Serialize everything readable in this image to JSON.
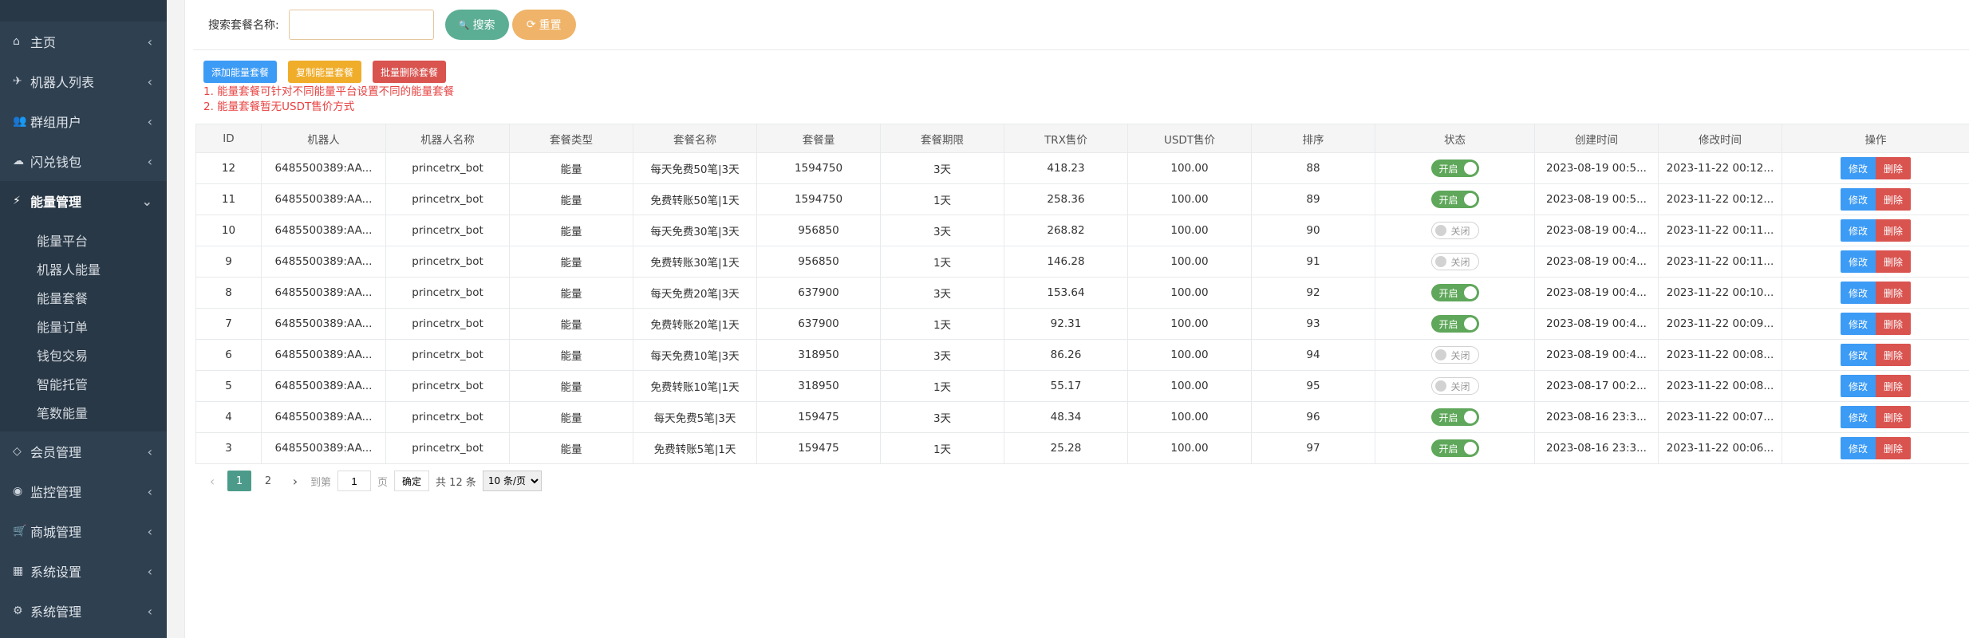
{
  "sidebar": {
    "items": [
      {
        "label": "主页",
        "icon": "home-icon",
        "glyph": "⌂",
        "arrow": "‹"
      },
      {
        "label": "机器人列表",
        "icon": "plane-icon",
        "glyph": "✈",
        "arrow": "‹"
      },
      {
        "label": "群组用户",
        "icon": "users-icon",
        "glyph": "👥",
        "arrow": "‹"
      },
      {
        "label": "闪兑钱包",
        "icon": "cloud-icon",
        "glyph": "☁",
        "arrow": "‹"
      },
      {
        "label": "能量管理",
        "icon": "bolt-icon",
        "glyph": "⚡",
        "arrow": "⌄"
      }
    ],
    "submenu": [
      "能量平台",
      "机器人能量",
      "能量套餐",
      "能量订单",
      "钱包交易",
      "智能托管",
      "笔数能量"
    ],
    "items_after": [
      {
        "label": "会员管理",
        "icon": "diamond-icon",
        "glyph": "◇",
        "arrow": "‹"
      },
      {
        "label": "监控管理",
        "icon": "monitor-icon",
        "glyph": "◉",
        "arrow": "‹"
      },
      {
        "label": "商城管理",
        "icon": "cart-icon",
        "glyph": "🛒",
        "arrow": "‹"
      },
      {
        "label": "系统设置",
        "icon": "windows-icon",
        "glyph": "▦",
        "arrow": "‹"
      },
      {
        "label": "系统管理",
        "icon": "gear-icon",
        "glyph": "⚙",
        "arrow": "‹"
      }
    ]
  },
  "search": {
    "label": "搜索套餐名称:",
    "value": "",
    "search_button": "搜索",
    "search_icon": "🔍",
    "reset_button": "重置",
    "reset_icon": "⟳"
  },
  "toolbar": {
    "add_label": "添加能量套餐",
    "copy_label": "复制能量套餐",
    "batch_delete_label": "批量删除套餐"
  },
  "notes": [
    "1. 能量套餐可针对不同能量平台设置不同的能量套餐",
    "2. 能量套餐暂无USDT售价方式"
  ],
  "table": {
    "headers": [
      "ID",
      "机器人",
      "机器人名称",
      "套餐类型",
      "套餐名称",
      "套餐量",
      "套餐期限",
      "TRX售价",
      "USDT售价",
      "排序",
      "状态",
      "创建时间",
      "修改时间",
      "操作"
    ],
    "on_label": "开启",
    "off_label": "关闭",
    "edit_label": "修改",
    "delete_label": "删除",
    "rows": [
      {
        "id": "12",
        "bot": "6485500389:AA...",
        "bot_name": "princetrx_bot",
        "type": "能量",
        "name": "每天免费50笔|3天",
        "amount": "1594750",
        "period": "3天",
        "trx": "418.23",
        "usdt": "100.00",
        "sort": "88",
        "status": "on",
        "created": "2023-08-19 00:5...",
        "modified": "2023-11-22 00:12..."
      },
      {
        "id": "11",
        "bot": "6485500389:AA...",
        "bot_name": "princetrx_bot",
        "type": "能量",
        "name": "免费转账50笔|1天",
        "amount": "1594750",
        "period": "1天",
        "trx": "258.36",
        "usdt": "100.00",
        "sort": "89",
        "status": "on",
        "created": "2023-08-19 00:5...",
        "modified": "2023-11-22 00:12..."
      },
      {
        "id": "10",
        "bot": "6485500389:AA...",
        "bot_name": "princetrx_bot",
        "type": "能量",
        "name": "每天免费30笔|3天",
        "amount": "956850",
        "period": "3天",
        "trx": "268.82",
        "usdt": "100.00",
        "sort": "90",
        "status": "off",
        "created": "2023-08-19 00:4...",
        "modified": "2023-11-22 00:11..."
      },
      {
        "id": "9",
        "bot": "6485500389:AA...",
        "bot_name": "princetrx_bot",
        "type": "能量",
        "name": "免费转账30笔|1天",
        "amount": "956850",
        "period": "1天",
        "trx": "146.28",
        "usdt": "100.00",
        "sort": "91",
        "status": "off",
        "created": "2023-08-19 00:4...",
        "modified": "2023-11-22 00:11..."
      },
      {
        "id": "8",
        "bot": "6485500389:AA...",
        "bot_name": "princetrx_bot",
        "type": "能量",
        "name": "每天免费20笔|3天",
        "amount": "637900",
        "period": "3天",
        "trx": "153.64",
        "usdt": "100.00",
        "sort": "92",
        "status": "on",
        "created": "2023-08-19 00:4...",
        "modified": "2023-11-22 00:10..."
      },
      {
        "id": "7",
        "bot": "6485500389:AA...",
        "bot_name": "princetrx_bot",
        "type": "能量",
        "name": "免费转账20笔|1天",
        "amount": "637900",
        "period": "1天",
        "trx": "92.31",
        "usdt": "100.00",
        "sort": "93",
        "status": "on",
        "created": "2023-08-19 00:4...",
        "modified": "2023-11-22 00:09..."
      },
      {
        "id": "6",
        "bot": "6485500389:AA...",
        "bot_name": "princetrx_bot",
        "type": "能量",
        "name": "每天免费10笔|3天",
        "amount": "318950",
        "period": "3天",
        "trx": "86.26",
        "usdt": "100.00",
        "sort": "94",
        "status": "off",
        "created": "2023-08-19 00:4...",
        "modified": "2023-11-22 00:08..."
      },
      {
        "id": "5",
        "bot": "6485500389:AA...",
        "bot_name": "princetrx_bot",
        "type": "能量",
        "name": "免费转账10笔|1天",
        "amount": "318950",
        "period": "1天",
        "trx": "55.17",
        "usdt": "100.00",
        "sort": "95",
        "status": "off",
        "created": "2023-08-17 00:2...",
        "modified": "2023-11-22 00:08..."
      },
      {
        "id": "4",
        "bot": "6485500389:AA...",
        "bot_name": "princetrx_bot",
        "type": "能量",
        "name": "每天免费5笔|3天",
        "amount": "159475",
        "period": "3天",
        "trx": "48.34",
        "usdt": "100.00",
        "sort": "96",
        "status": "on",
        "created": "2023-08-16 23:3...",
        "modified": "2023-11-22 00:07..."
      },
      {
        "id": "3",
        "bot": "6485500389:AA...",
        "bot_name": "princetrx_bot",
        "type": "能量",
        "name": "免费转账5笔|1天",
        "amount": "159475",
        "period": "1天",
        "trx": "25.28",
        "usdt": "100.00",
        "sort": "97",
        "status": "on",
        "created": "2023-08-16 23:3...",
        "modified": "2023-11-22 00:06..."
      }
    ]
  },
  "pagination": {
    "prev": "‹",
    "next": "›",
    "pages": [
      "1",
      "2"
    ],
    "current": "1",
    "goto_label": "到第",
    "goto_value": "1",
    "page_unit": "页",
    "confirm": "确定",
    "total": "共 12 条",
    "page_size": "10 条/页"
  },
  "colors": {
    "sidebar_bg": "#2f4050",
    "search_btn": "#5bae94",
    "reset_btn": "#efb469",
    "toggle_on": "#5fa75a",
    "edit_btn": "#3c9bf5",
    "delete_btn": "#d9534f",
    "notes_red": "#e84141",
    "pager_current": "#4c9b8a"
  }
}
